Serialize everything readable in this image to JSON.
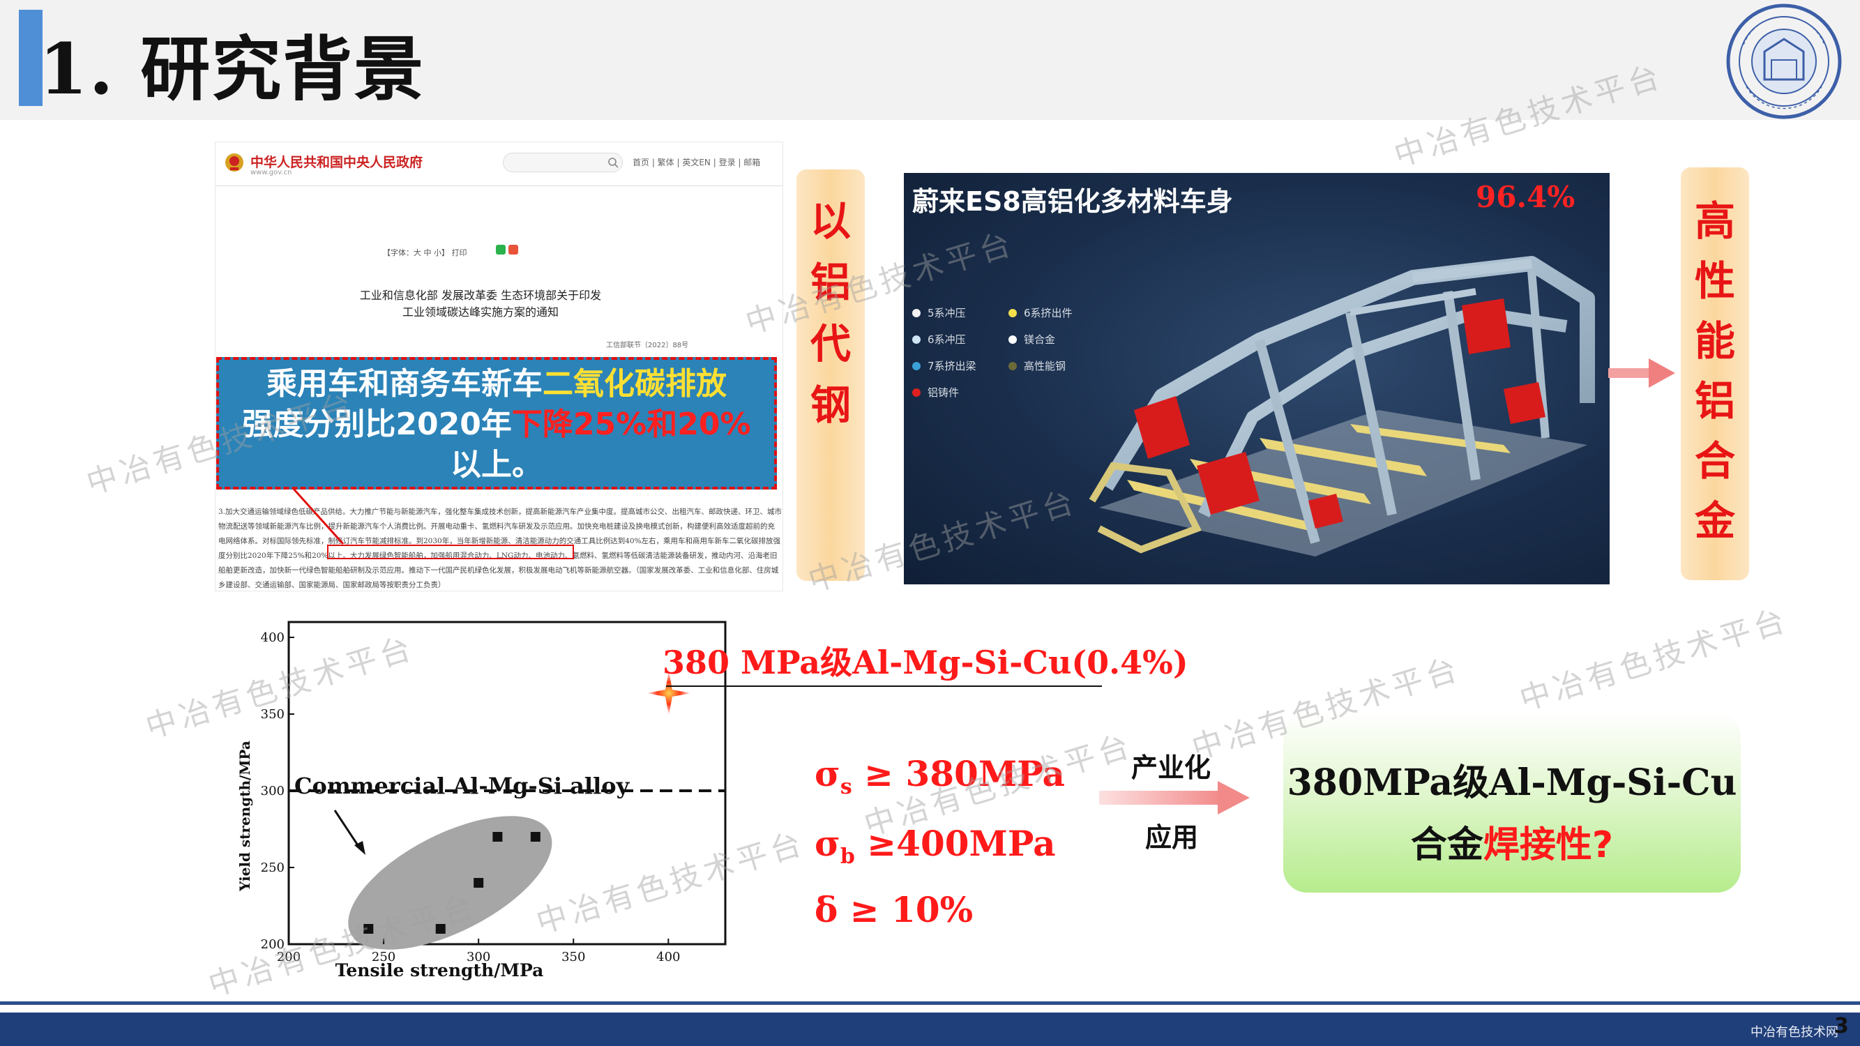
{
  "slide": {
    "title": "1. 研究背景",
    "page_number": "3",
    "footer_brand": "中冶有色技术网"
  },
  "gov_doc": {
    "site_name": "中华人民共和国中央人民政府",
    "site_url": "www.gov.cn",
    "nav": "首页 | 繁体 | 英文EN | 登录 | 邮箱",
    "toolbar": "【字体：大 中 小】  打印",
    "heading_line1": "工业和信息化部 发展改革委 生态环境部关于印发",
    "heading_line2": "工业领域碳达峰实施方案的通知",
    "doc_number": "工信部联节〔2022〕88号",
    "body_text": "3.加大交通运输领域绿色低碳产品供给。大力推广节能与新能源汽车，强化整车集成技术创新，提高新能源汽车产业集中度。提高城市公交、出租汽车、邮政快递、环卫、城市物流配送等领域新能源汽车比例，提升新能源汽车个人消费比例。开展电动重卡、氢燃料汽车研发及示范应用。加快充电桩建设及换电模式创新，构建便利高效适度超前的充电网络体系。对标国际领先标准，制修订汽车节能减排标准。到2030年，当年新增新能源、清洁能源动力的交通工具比例达到40%左右，乘用车和商用车新车二氧化碳排放强度分别比2020年下降25%和20%以上。大力发展绿色智能船舶，加强船用混合动力、LNG动力、电池动力、氨燃料、氢燃料等低碳清洁能源装备研发，推动内河、沿海老旧船舶更新改造，加快新一代绿色智能船舶研制及示范应用。推动下一代国产民机绿色化发展，积极发展电动飞机等新能源航空器。（国家发展改革委、工业和信息化部、住房城乡建设部、交通运输部、国家能源局、国家邮政局等按职责分工负责）"
  },
  "callout": {
    "part1": "乘用车和商务车新车",
    "part2": "二氧化碳排放",
    "part3": "强度分别比2020年",
    "part4": "下降25%和20%",
    "part5": "以上。"
  },
  "banner_left": [
    "以",
    "铝",
    "代",
    "钢"
  ],
  "banner_right": [
    "高",
    "性",
    "能",
    "铝",
    "合",
    "金"
  ],
  "car_panel": {
    "title": "蔚来ES8高铝化多材料车身",
    "percentage": "96.4%",
    "legend": [
      {
        "label": "5系冲压",
        "color": "#f2f2f2"
      },
      {
        "label": "6系挤出件",
        "color": "#f4e04d"
      },
      {
        "label": "6系冲压",
        "color": "#cfe4f5"
      },
      {
        "label": "镁合金",
        "color": "#ffffff"
      },
      {
        "label": "7系挤出梁",
        "color": "#3aa0d8"
      },
      {
        "label": "高性能钢",
        "color": "#6b6b3a"
      },
      {
        "label": "铝铸件",
        "color": "#e02020"
      }
    ]
  },
  "chart_data": {
    "type": "scatter",
    "xlabel": "Tensile strength/MPa",
    "ylabel": "Yield strength/MPa",
    "xlim": [
      200,
      430
    ],
    "ylim": [
      200,
      410
    ],
    "x_ticks": [
      "200",
      "250",
      "300",
      "350",
      "400"
    ],
    "y_ticks": [
      "200",
      "250",
      "300",
      "350",
      "400"
    ],
    "series": [
      {
        "x": [
          242,
          280,
          300,
          310,
          330
        ],
        "y": [
          210,
          210,
          240,
          270,
          270
        ]
      }
    ],
    "reference_line": {
      "y": 300,
      "label": "Commercial Al-Mg-Si alloy"
    },
    "highlight_point": {
      "x": 400,
      "y": 380,
      "label": "380 MPa级Al-Mg-Si-Cu(0.4%)"
    }
  },
  "properties": {
    "p1_symbol": "σ",
    "p1_sub": "s",
    "p1_value": " ≥ 380MPa",
    "p2_symbol": "σ",
    "p2_sub": "b",
    "p2_value": " ≥400MPa",
    "p3": "δ ≥ 10%"
  },
  "industrialization": {
    "line1": "产业化",
    "line2": "应用"
  },
  "green_box": {
    "line1": "380MPa级Al-Mg-Si-Cu",
    "line2_a": "合金",
    "line2_b": "焊接性?"
  },
  "watermark": "中冶有色技术平台",
  "colors": {
    "accent_red": "#ff1a1a",
    "title_bar": "#4f8fd6",
    "callout_bg": "#2b83b8",
    "footer": "#1f3f7a",
    "green_box": "#b6ec8d",
    "banner": "#fbd79e"
  }
}
